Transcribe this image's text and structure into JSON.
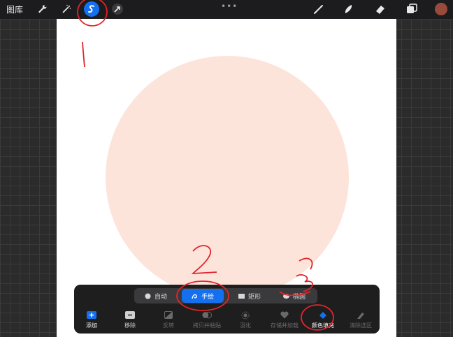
{
  "topbar": {
    "gallery_label": "图库",
    "more_label": "•••",
    "color_swatch": "#9a4a3a"
  },
  "canvas": {
    "background": "#ffffff",
    "circle_color": "#fde4da"
  },
  "selection_modes": [
    {
      "label": "自动",
      "icon": "auto-icon",
      "active": false
    },
    {
      "label": "手绘",
      "icon": "freehand-icon",
      "active": true
    },
    {
      "label": "矩形",
      "icon": "rectangle-icon",
      "active": false
    },
    {
      "label": "椭圆",
      "icon": "ellipse-icon",
      "active": false
    }
  ],
  "tools": [
    {
      "label": "添加",
      "icon": "add-icon",
      "enabled": true
    },
    {
      "label": "移除",
      "icon": "remove-icon",
      "enabled": true
    },
    {
      "label": "反转",
      "icon": "invert-icon",
      "enabled": false
    },
    {
      "label": "拷贝并粘贴",
      "icon": "copy-paste-icon",
      "enabled": false
    },
    {
      "label": "羽化",
      "icon": "feather-icon",
      "enabled": false
    },
    {
      "label": "存储并加载",
      "icon": "save-load-icon",
      "enabled": false
    },
    {
      "label": "颜色填充",
      "icon": "color-fill-icon",
      "enabled": true
    },
    {
      "label": "清除选区",
      "icon": "clear-selection-icon",
      "enabled": false
    }
  ],
  "annotations": {
    "mark_1": "1",
    "mark_2": "2",
    "mark_3": "3",
    "color": "#e0242c"
  },
  "colors": {
    "accent": "#1570ef"
  }
}
